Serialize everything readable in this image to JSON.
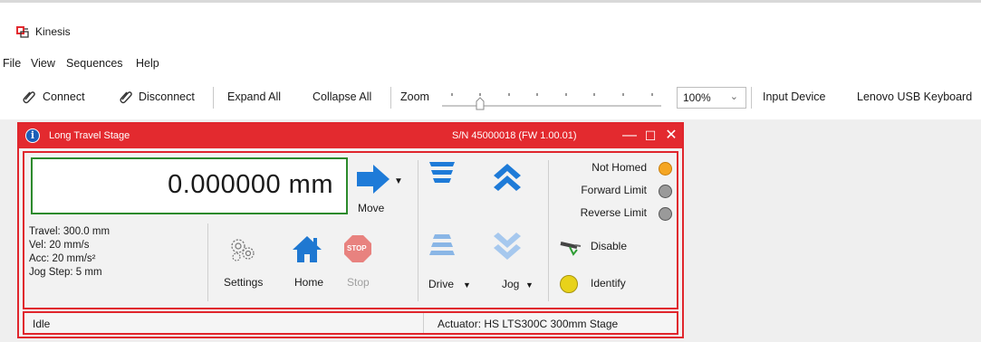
{
  "app": {
    "title": "Kinesis"
  },
  "menu": [
    "File",
    "View",
    "Sequences",
    "Help"
  ],
  "toolbar": {
    "connect": "Connect",
    "disconnect": "Disconnect",
    "expand_all": "Expand All",
    "collapse_all": "Collapse All",
    "zoom_label": "Zoom",
    "zoom_value": "100%",
    "input_device_label": "Input Device",
    "input_device_value": "Lenovo USB Keyboard"
  },
  "panel": {
    "title": "Long Travel Stage",
    "serial": "S/N 45000018 (FW 1.00.01)",
    "position": "0.000000 mm",
    "params": {
      "travel": "Travel: 300.0 mm",
      "vel": "Vel: 20 mm/s",
      "acc": "Acc: 20 mm/s²",
      "jog_step": "Jog Step: 5 mm"
    },
    "buttons": {
      "move": "Move",
      "settings": "Settings",
      "home": "Home",
      "stop": "Stop",
      "stop_icon_text": "STOP",
      "drive": "Drive",
      "jog": "Jog",
      "disable": "Disable",
      "identify": "Identify"
    },
    "status": {
      "not_homed": "Not Homed",
      "forward_limit": "Forward Limit",
      "reverse_limit": "Reverse Limit"
    },
    "statusbar": {
      "state": "Idle",
      "actuator": "Actuator:  HS LTS300C 300mm Stage"
    }
  },
  "colors": {
    "accent_red": "#e32a2f",
    "position_border": "#2c8a2c",
    "arrow_blue": "#1e7bd8",
    "home_blue": "#1f78d1",
    "led_orange": "#f5a623",
    "led_gray": "#9a9a9a",
    "led_yellow": "#e8d21a"
  }
}
